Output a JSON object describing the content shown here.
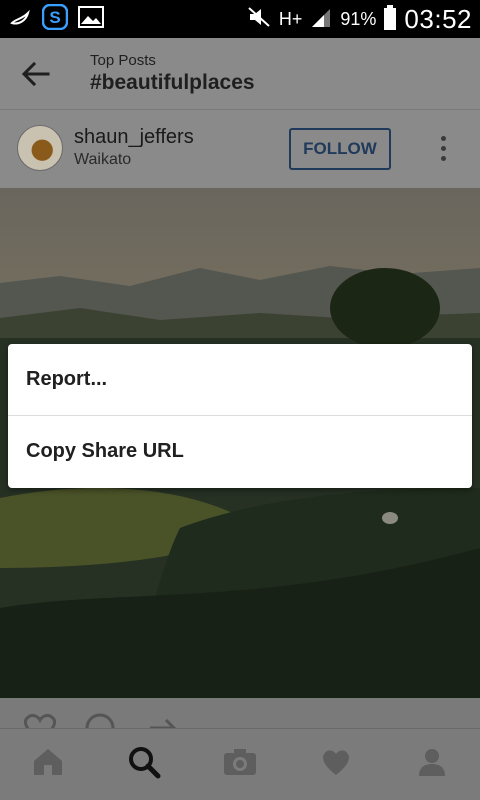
{
  "status_bar": {
    "battery": "91%",
    "network": "H+",
    "time": "03:52"
  },
  "header": {
    "subtitle": "Top Posts",
    "title": "#beautifulplaces"
  },
  "post": {
    "username": "shaun_jeffers",
    "location": "Waikato",
    "follow_label": "FOLLOW"
  },
  "dialog": {
    "items": [
      {
        "label": "Report..."
      },
      {
        "label": "Copy Share URL"
      }
    ]
  },
  "bottom_nav": {
    "items": [
      "home-icon",
      "search-icon",
      "camera-icon",
      "heart-icon",
      "profile-icon"
    ],
    "active": "search-icon"
  },
  "colors": {
    "accent": "#1f3a5a",
    "dialog_bg": "#ffffff",
    "statusbar_bg": "#000000"
  }
}
